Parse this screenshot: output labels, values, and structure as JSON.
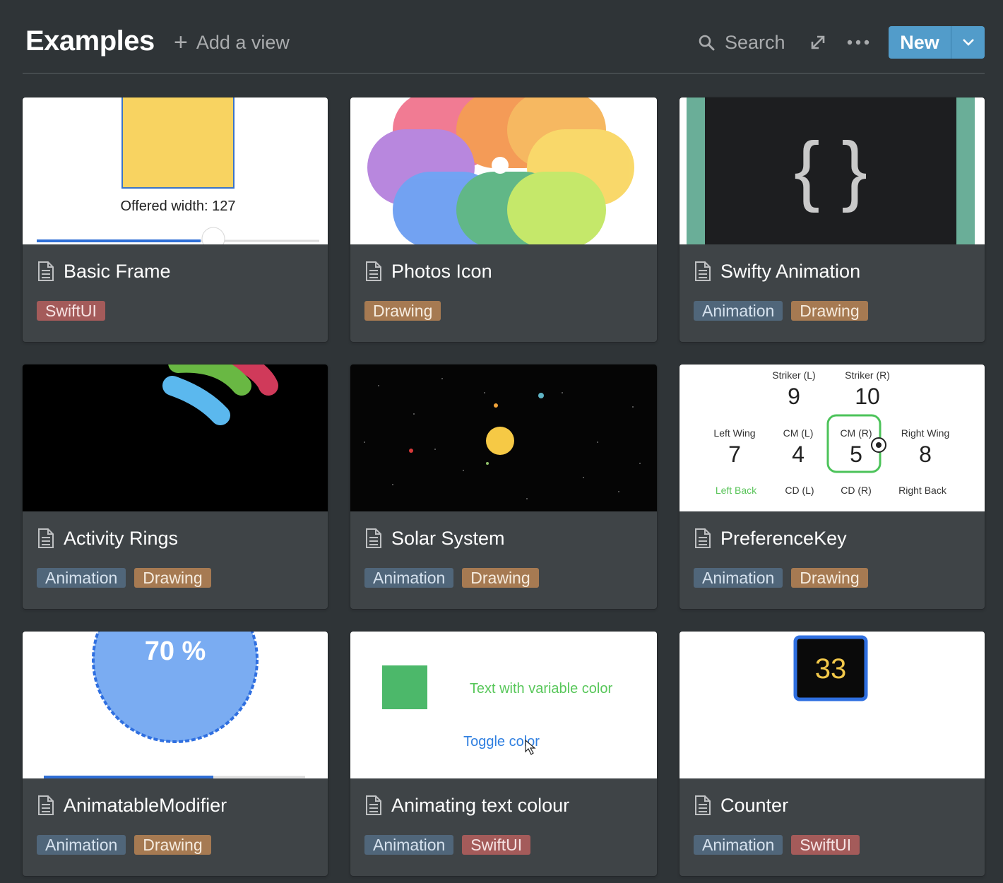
{
  "header": {
    "title": "Examples",
    "add_view_label": "Add a view",
    "search_label": "Search",
    "new_label": "New"
  },
  "colors": {
    "background": "#2f3437",
    "card": "#3f4447",
    "accent": "#529cca",
    "tag_swiftui": "#a45b5a",
    "tag_drawing": "#a67a52",
    "tag_animation": "#50667a"
  },
  "cards": [
    {
      "title": "Basic Frame",
      "tags": [
        "SwiftUI"
      ],
      "cover_text": [
        "Offered width: 127"
      ]
    },
    {
      "title": "Photos Icon",
      "tags": [
        "Drawing"
      ],
      "cover_text": []
    },
    {
      "title": "Swifty Animation",
      "tags": [
        "Animation",
        "Drawing"
      ],
      "cover_text": [
        "{ }"
      ]
    },
    {
      "title": "Activity Rings",
      "tags": [
        "Animation",
        "Drawing"
      ],
      "cover_text": []
    },
    {
      "title": "Solar System",
      "tags": [
        "Animation",
        "Drawing"
      ],
      "cover_text": []
    },
    {
      "title": "PreferenceKey",
      "tags": [
        "Animation",
        "Drawing"
      ],
      "cover_text": [
        "Striker (L)",
        "9",
        "Striker (R)",
        "10",
        "Left Wing",
        "7",
        "CM (L)",
        "4",
        "CM (R)",
        "5",
        "Right Wing",
        "8",
        "Left Back",
        "CD (L)",
        "CD (R)",
        "Right Back"
      ]
    },
    {
      "title": "AnimatableModifier",
      "tags": [
        "Animation",
        "Drawing"
      ],
      "cover_text": [
        "70 %"
      ]
    },
    {
      "title": "Animating text colour",
      "tags": [
        "Animation",
        "SwiftUI"
      ],
      "cover_text": [
        "Text with variable color",
        "Toggle color"
      ]
    },
    {
      "title": "Counter",
      "tags": [
        "Animation",
        "SwiftUI"
      ],
      "cover_text": [
        "33"
      ]
    }
  ]
}
